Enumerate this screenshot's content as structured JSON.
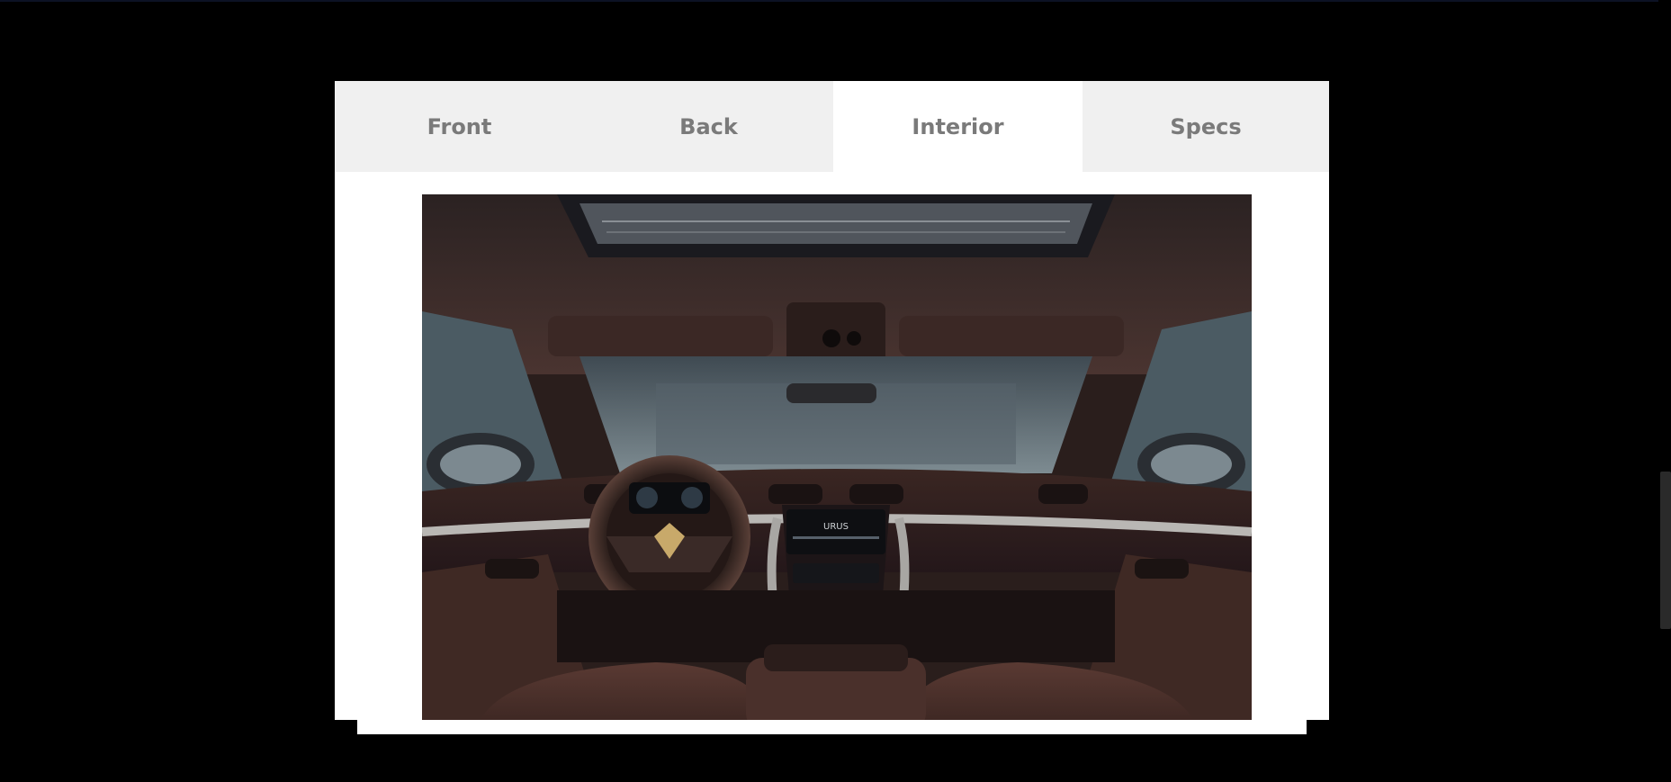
{
  "tabs": [
    {
      "label": "Front",
      "active": false
    },
    {
      "label": "Back",
      "active": false
    },
    {
      "label": "Interior",
      "active": true
    },
    {
      "label": "Specs",
      "active": false
    }
  ],
  "photo": {
    "subject": "car-interior-dashboard",
    "brand_badge_text": "URUS"
  },
  "colors": {
    "page_background": "#000000",
    "card_background": "#ffffff",
    "tab_inactive_background": "#f0f0f0",
    "tab_text": "#7a7a7a",
    "leather": "#4a302b"
  }
}
